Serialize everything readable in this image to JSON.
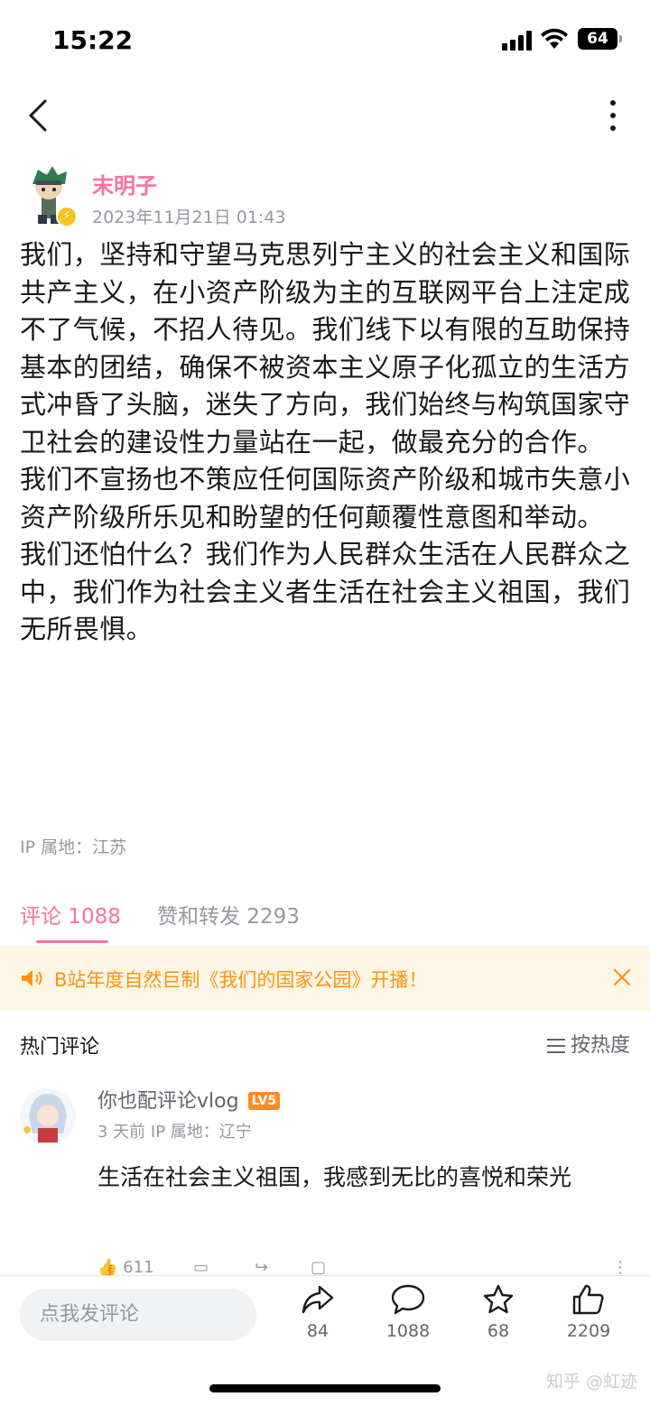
{
  "status_bar": {
    "time": "15:22",
    "battery": "64"
  },
  "author": {
    "name": "末明子",
    "post_time": "2023年11月21日 01:43"
  },
  "post": {
    "paragraphs": [
      "我们，坚持和守望马克思列宁主义的社会主义和国际共产主义，在小资产阶级为主的互联网平台上注定成不了气候，不招人待见。我们线下以有限的互助保持基本的团结，确保不被资本主义原子化孤立的生活方式冲昏了头脑，迷失了方向，我们始终与构筑国家守卫社会的建设性力量站在一起，做最充分的合作。",
      "我们不宣扬也不策应任何国际资产阶级和城市失意小资产阶级所乐见和盼望的任何颠覆性意图和举动。",
      "我们还怕什么？我们作为人民群众生活在人民群众之中，我们作为社会主义者生活在社会主义祖国，我们无所畏惧。"
    ],
    "ip_location": "IP 属地：江苏"
  },
  "tabs": {
    "comments": "评论 1088",
    "likes_reposts": "赞和转发 2293"
  },
  "notice": {
    "text": "B站年度自然巨制《我们的国家公园》开播！"
  },
  "hot_comments": {
    "title": "热门评论",
    "sort_label": "按热度",
    "items": [
      {
        "user": "你也配评论vlog",
        "level": "LV5",
        "meta": "3 天前  IP 属地：辽宁",
        "text": "生活在社会主义祖国，我感到无比的喜悦和荣光",
        "likes": "611"
      }
    ]
  },
  "bottom_bar": {
    "input_placeholder": "点我发评论",
    "share_count": "84",
    "comment_count": "1088",
    "favorite_count": "68",
    "like_count": "2209",
    "watermark": "知乎 @虹迹"
  },
  "colors": {
    "accent": "#fb7299",
    "notice_bg": "#fdf6e4",
    "notice_text": "#ff9212",
    "level_badge": "#ff8a25"
  }
}
